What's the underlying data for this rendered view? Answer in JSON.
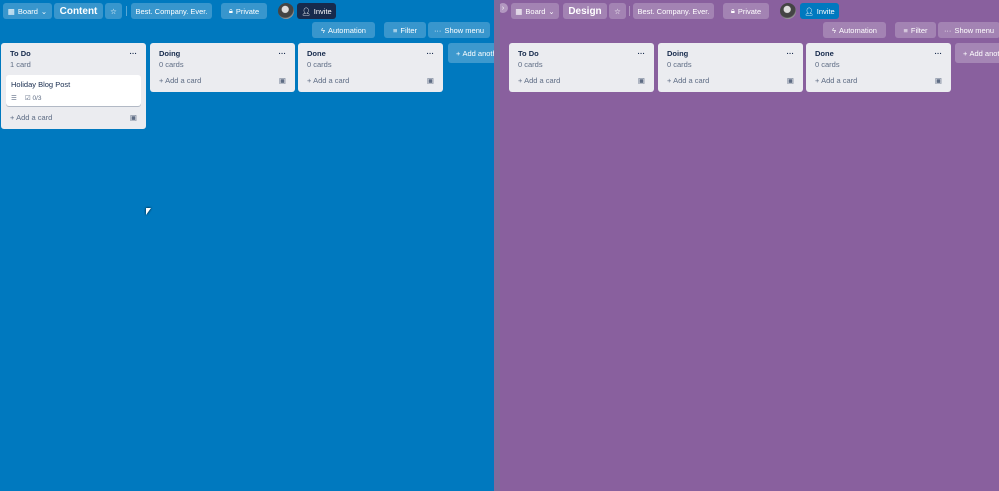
{
  "boards": [
    {
      "name": "Content",
      "view": "Board",
      "team": "Best. Company. Ever.",
      "visibility": "Private",
      "invite": "Invite",
      "automation": "Automation",
      "filter": "Filter",
      "show_menu": "Show menu",
      "add_list": "Add another list",
      "lists": [
        {
          "title": "To Do",
          "count": "1 card",
          "cards": [
            {
              "title": "Holiday Blog Post",
              "checklist": "0/3"
            }
          ],
          "add": "Add a card"
        },
        {
          "title": "Doing",
          "count": "0 cards",
          "cards": [],
          "add": "Add a card"
        },
        {
          "title": "Done",
          "count": "0 cards",
          "cards": [],
          "add": "Add a card"
        }
      ]
    },
    {
      "name": "Design",
      "view": "Board",
      "team": "Best. Company. Ever.",
      "visibility": "Private",
      "invite": "Invite",
      "automation": "Automation",
      "filter": "Filter",
      "show_menu": "Show menu",
      "add_list": "Add another list",
      "lists": [
        {
          "title": "To Do",
          "count": "0 cards",
          "cards": [],
          "add": "Add a card"
        },
        {
          "title": "Doing",
          "count": "0 cards",
          "cards": [],
          "add": "Add a card"
        },
        {
          "title": "Done",
          "count": "0 cards",
          "cards": [],
          "add": "Add a card"
        }
      ]
    }
  ],
  "colors": {
    "content_bg": "#0079bf",
    "design_bg": "#89609e"
  }
}
